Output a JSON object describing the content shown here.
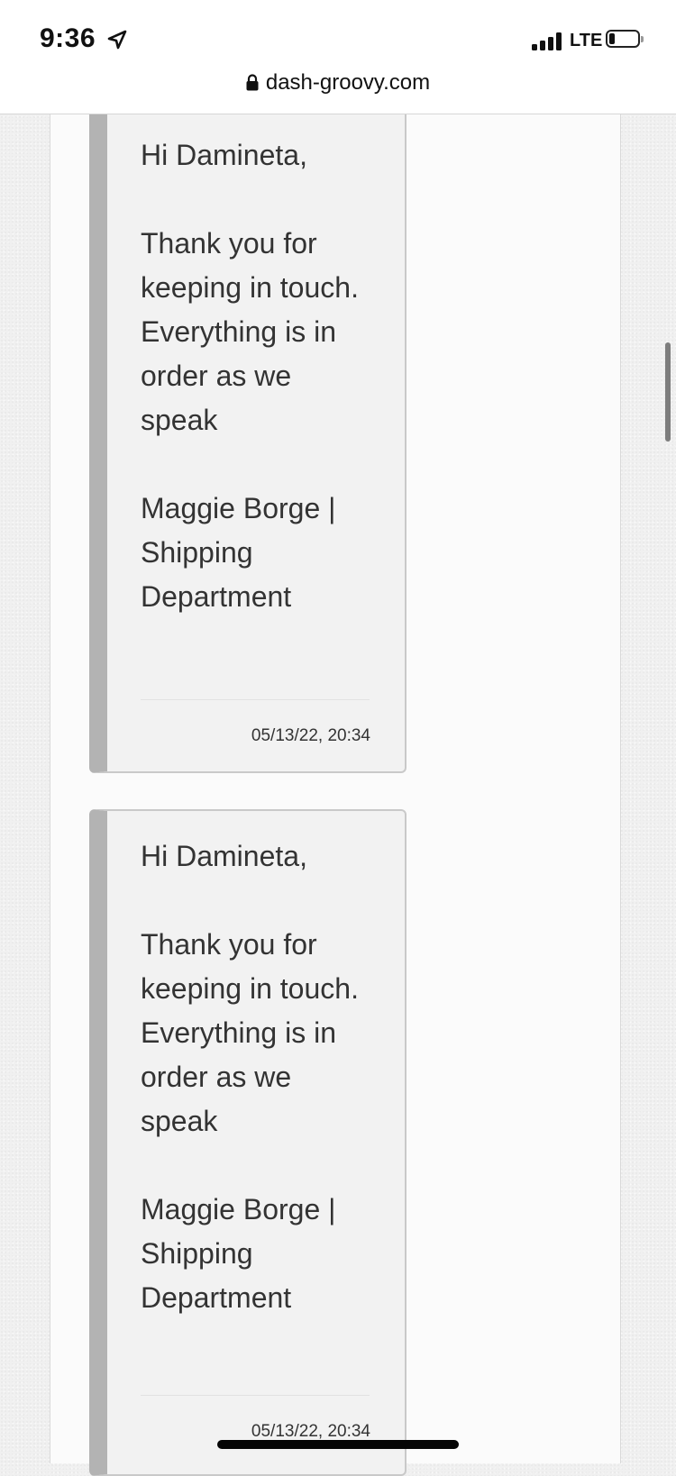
{
  "status_bar": {
    "time": "9:36",
    "carrier": "LTE",
    "signal_bars_filled": 4,
    "battery_fraction": 0.15,
    "location_icon": "location-arrow-icon"
  },
  "browser": {
    "url": "dash-groovy.com",
    "lock_icon": "lock-icon"
  },
  "messages": [
    {
      "greeting": "Hi Damineta,",
      "body": "Thank you for keeping in touch. Everything is in order as we speak",
      "signature": "Maggie Borge | Shipping Department",
      "timestamp": "05/13/22, 20:34"
    },
    {
      "greeting": "Hi Damineta,",
      "body": "Thank you for keeping in touch. Everything is in order as we speak",
      "signature": "Maggie Borge | Shipping Department",
      "timestamp": "05/13/22, 20:34"
    }
  ],
  "colors": {
    "card_background": "#f2f2f2",
    "card_accent_bar": "#b3b3b3",
    "page_background": "#f0f0f0",
    "text": "#333333"
  }
}
